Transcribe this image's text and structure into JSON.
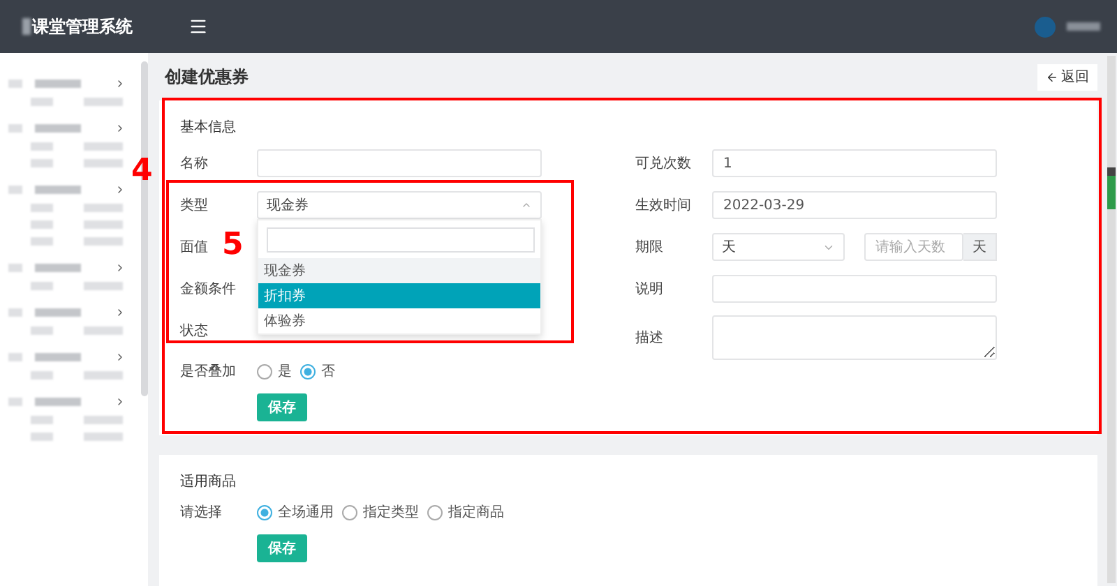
{
  "header": {
    "title": "课堂管理系统"
  },
  "page": {
    "title": "创建优惠券",
    "back_button": "返回"
  },
  "basic_info": {
    "title": "基本信息",
    "left_fields": [
      {
        "label": "名称",
        "kind": "text"
      },
      {
        "label": "类型",
        "kind": "select",
        "value": "现金券",
        "expanded": true,
        "options": [
          {
            "label": "现金券",
            "highlighted": false,
            "selected": true
          },
          {
            "label": "折扣券",
            "highlighted": true,
            "selected": false
          },
          {
            "label": "体验券",
            "highlighted": false,
            "selected": false
          }
        ]
      },
      {
        "label": "面值",
        "kind": "covered"
      },
      {
        "label": "金额条件",
        "kind": "covered"
      },
      {
        "label": "状态",
        "kind": "covered"
      }
    ],
    "stack": {
      "label": "是否叠加",
      "options": [
        {
          "label": "是",
          "selected": false
        },
        {
          "label": "否",
          "selected": true
        }
      ]
    },
    "save_button": "保存",
    "right_fields": [
      {
        "label": "可兑次数",
        "kind": "text",
        "value": "1"
      },
      {
        "label": "生效时间",
        "kind": "text",
        "value": "2022-03-29"
      },
      {
        "label": "期限",
        "kind": "period",
        "value": "天",
        "placeholder": "请输入天数",
        "addon": "天"
      },
      {
        "label": "说明",
        "kind": "text"
      },
      {
        "label": "描述",
        "kind": "textarea"
      }
    ]
  },
  "goods": {
    "title": "适用商品",
    "label": "请选择",
    "options": [
      {
        "label": "全场通用",
        "selected": true
      },
      {
        "label": "指定类型",
        "selected": false
      },
      {
        "label": "指定商品",
        "selected": false
      }
    ],
    "save_button": "保存"
  },
  "annotations": [
    {
      "label": "4"
    },
    {
      "label": "5"
    }
  ]
}
